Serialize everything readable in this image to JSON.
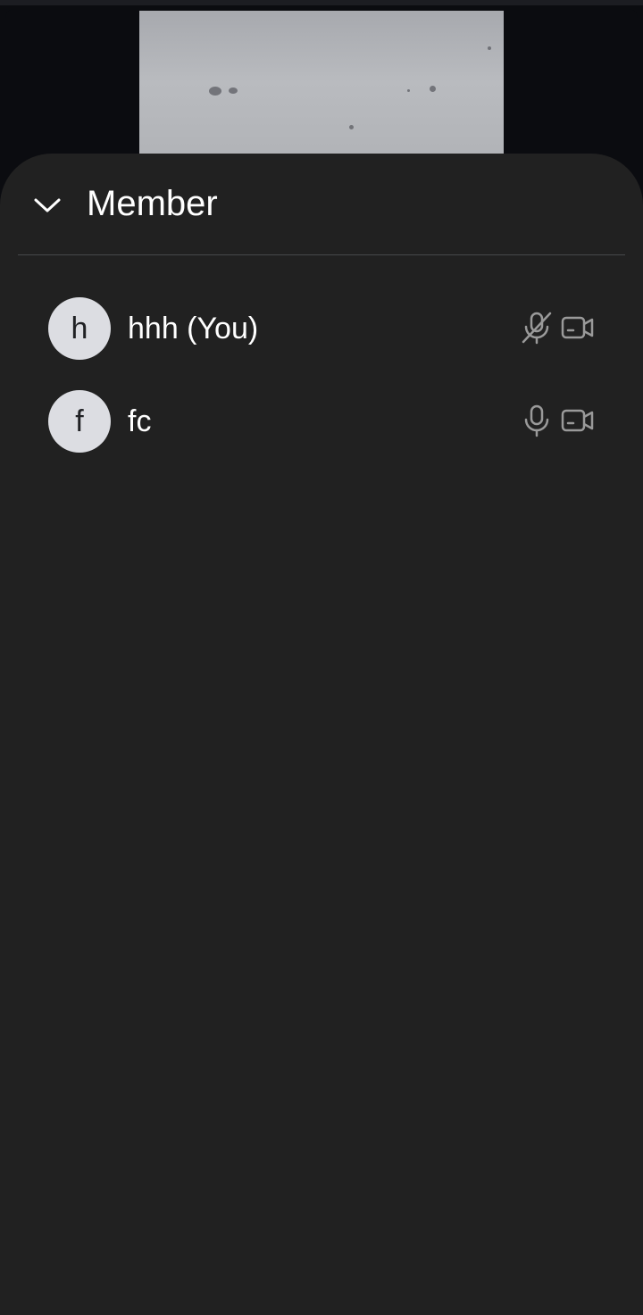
{
  "sheet": {
    "title": "Member",
    "collapse_icon": "chevron-down-icon"
  },
  "members": [
    {
      "initial": "h",
      "name": "hhh (You)",
      "mic_icon": "mic-off-icon",
      "camera_icon": "video-camera-icon"
    },
    {
      "initial": "f",
      "name": "fc",
      "mic_icon": "mic-icon",
      "camera_icon": "video-camera-icon"
    }
  ],
  "colors": {
    "sheet_background": "#212121",
    "page_background": "#0b0c10",
    "avatar_background": "#dcdde2",
    "icon_gray": "#9a9a9a",
    "text": "#ffffff"
  }
}
